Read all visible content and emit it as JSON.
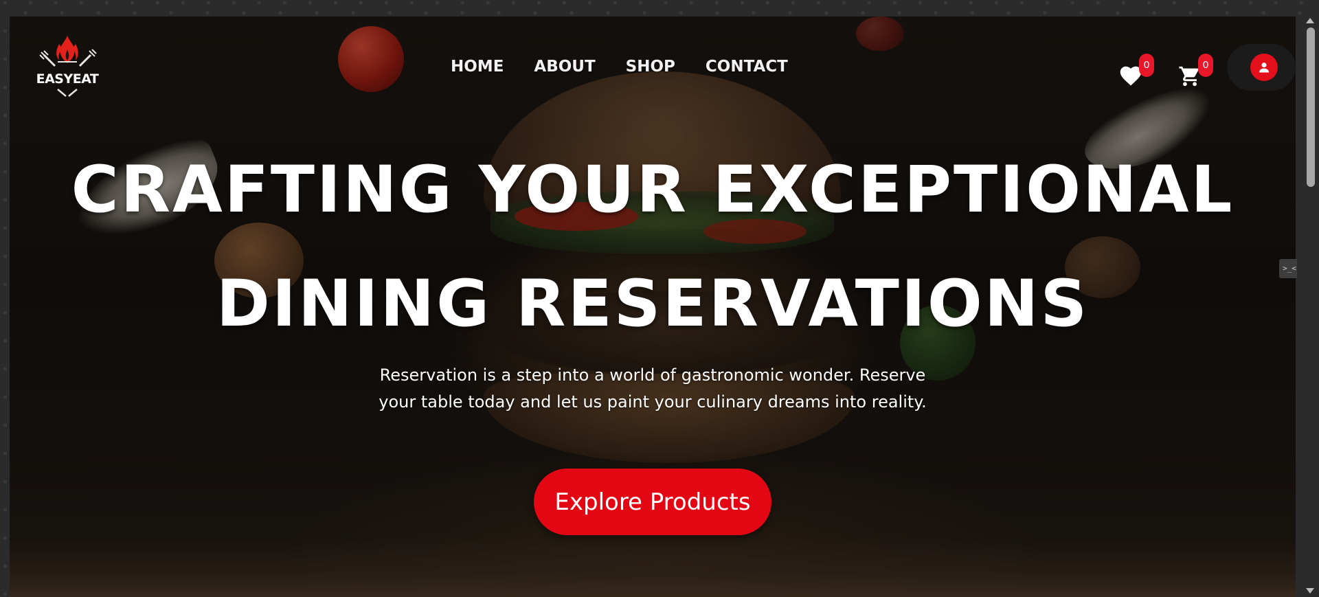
{
  "brand": {
    "name": "EASYEAT"
  },
  "nav": {
    "items": [
      {
        "label": "HOME"
      },
      {
        "label": "ABOUT"
      },
      {
        "label": "SHOP"
      },
      {
        "label": "CONTACT"
      }
    ]
  },
  "header_actions": {
    "wishlist_icon": "heart-icon",
    "wishlist_count": "0",
    "cart_icon": "shopping-cart-icon",
    "cart_count": "0",
    "account_icon": "user-icon"
  },
  "hero": {
    "title_line_1": "CRAFTING YOUR EXCEPTIONAL",
    "title_line_2": "DINING RESERVATIONS",
    "subtitle": "Reservation is a step into a world of gastronomic wonder. Reserve your table today and let us paint your culinary dreams into reality.",
    "cta_label": "Explore Products"
  },
  "colors": {
    "accent": "#e30613",
    "badge": "#e8172a",
    "text": "#ffffff"
  }
}
